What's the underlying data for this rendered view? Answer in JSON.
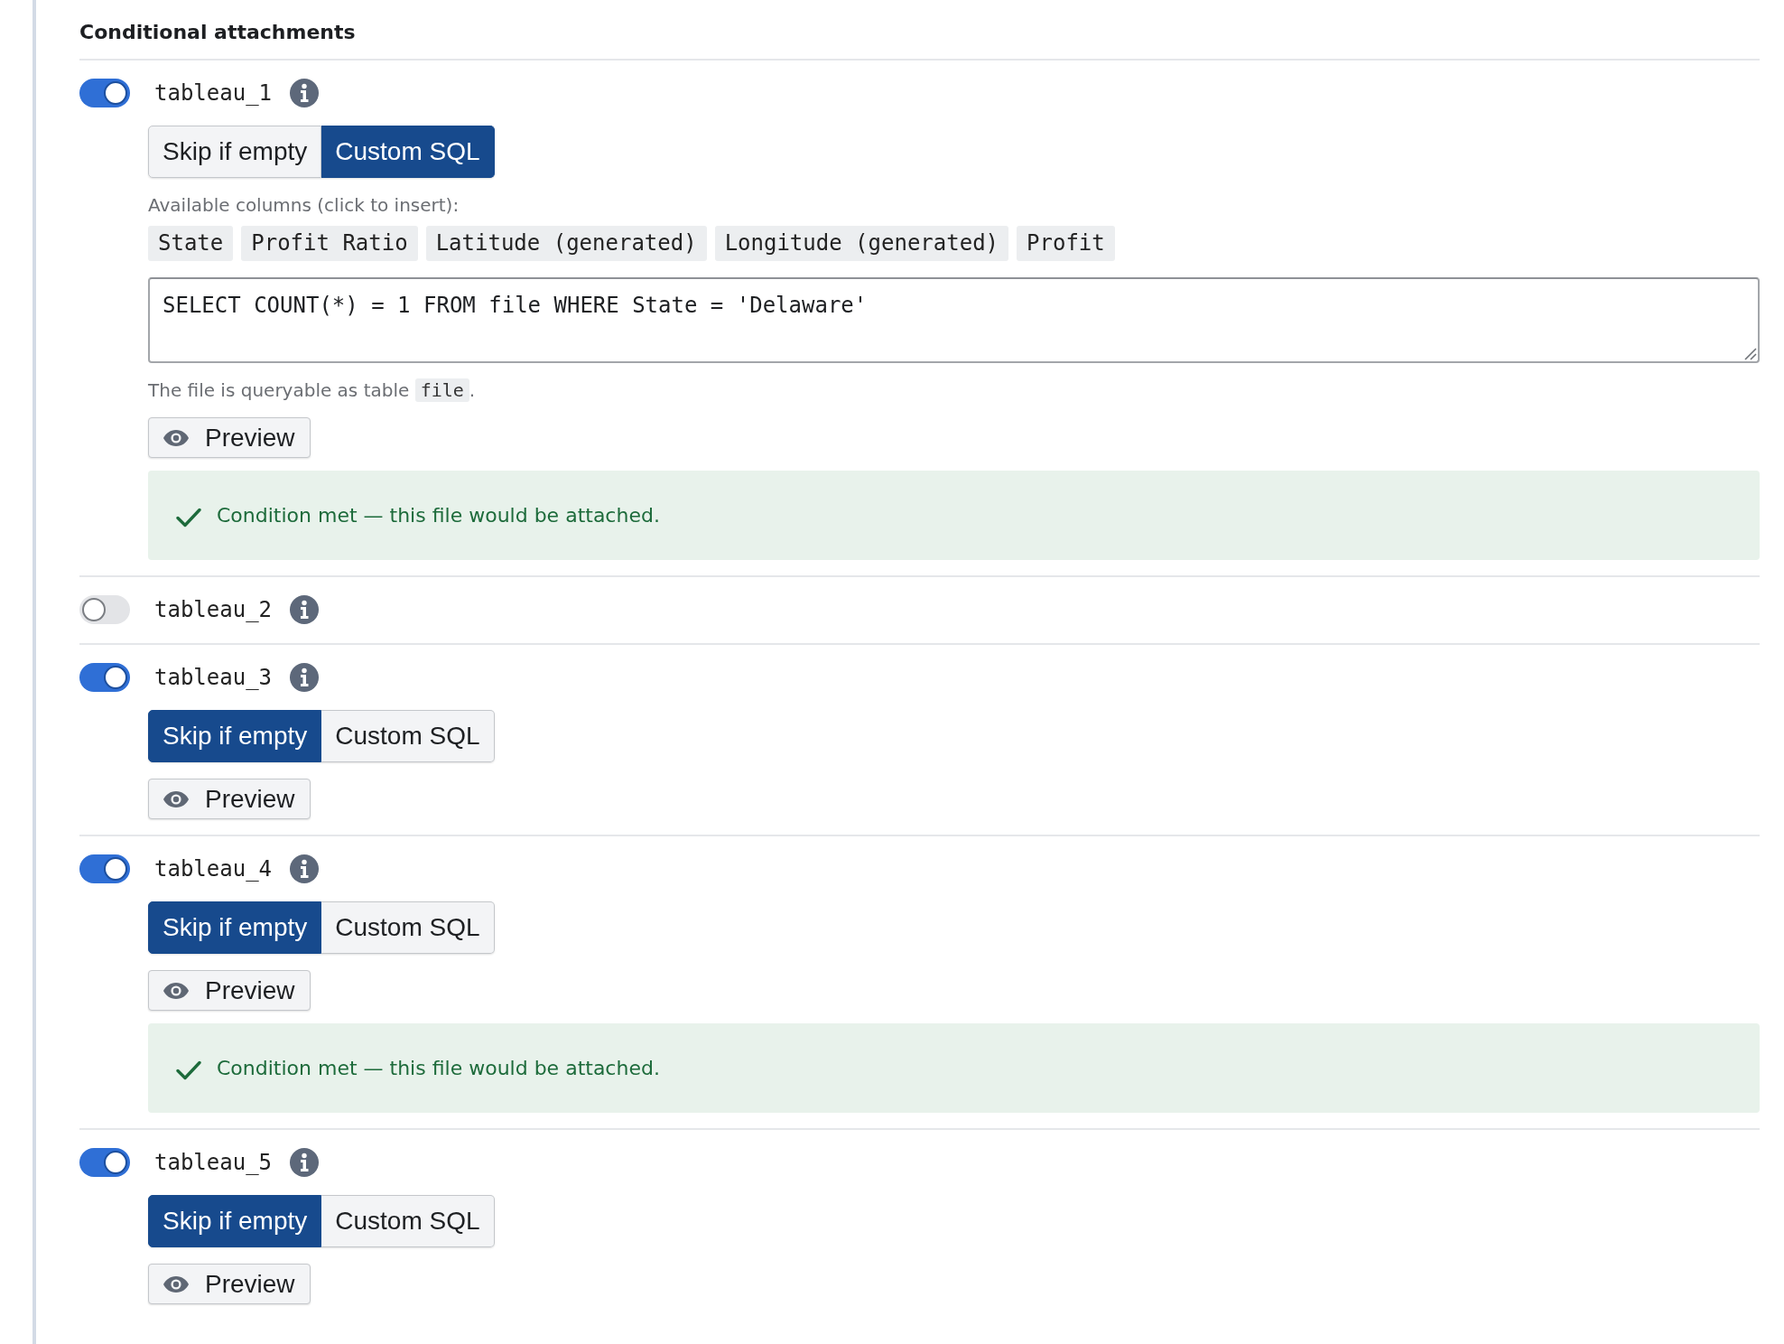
{
  "section": {
    "title": "Conditional attachments"
  },
  "attachments": [
    {
      "name": "tableau_1",
      "enabled": true,
      "modes": [
        {
          "label": "Skip if empty",
          "selected": false
        },
        {
          "label": "Custom SQL",
          "selected": true
        }
      ],
      "custom_sql": {
        "columns_label": "Available columns (click to insert):",
        "columns": [
          "State",
          "Profit Ratio",
          "Latitude (generated)",
          "Longitude (generated)",
          "Profit"
        ],
        "query": "SELECT COUNT(*) = 1 FROM file WHERE State = 'Delaware'",
        "help": {
          "before": "The file is queryable as table ",
          "code": "file",
          "after": "."
        }
      },
      "preview_button": "Preview",
      "result": {
        "kind": "success",
        "text": "Condition met — this file would be attached."
      }
    },
    {
      "name": "tableau_2",
      "enabled": false
    },
    {
      "name": "tableau_3",
      "enabled": true,
      "modes": [
        {
          "label": "Skip if empty",
          "selected": true
        },
        {
          "label": "Custom SQL",
          "selected": false
        }
      ],
      "preview_button": "Preview"
    },
    {
      "name": "tableau_4",
      "enabled": true,
      "modes": [
        {
          "label": "Skip if empty",
          "selected": true
        },
        {
          "label": "Custom SQL",
          "selected": false
        }
      ],
      "preview_button": "Preview",
      "result": {
        "kind": "success",
        "text": "Condition met — this file would be attached."
      }
    },
    {
      "name": "tableau_5",
      "enabled": true,
      "modes": [
        {
          "label": "Skip if empty",
          "selected": true
        },
        {
          "label": "Custom SQL",
          "selected": false
        }
      ],
      "preview_button": "Preview"
    }
  ]
}
